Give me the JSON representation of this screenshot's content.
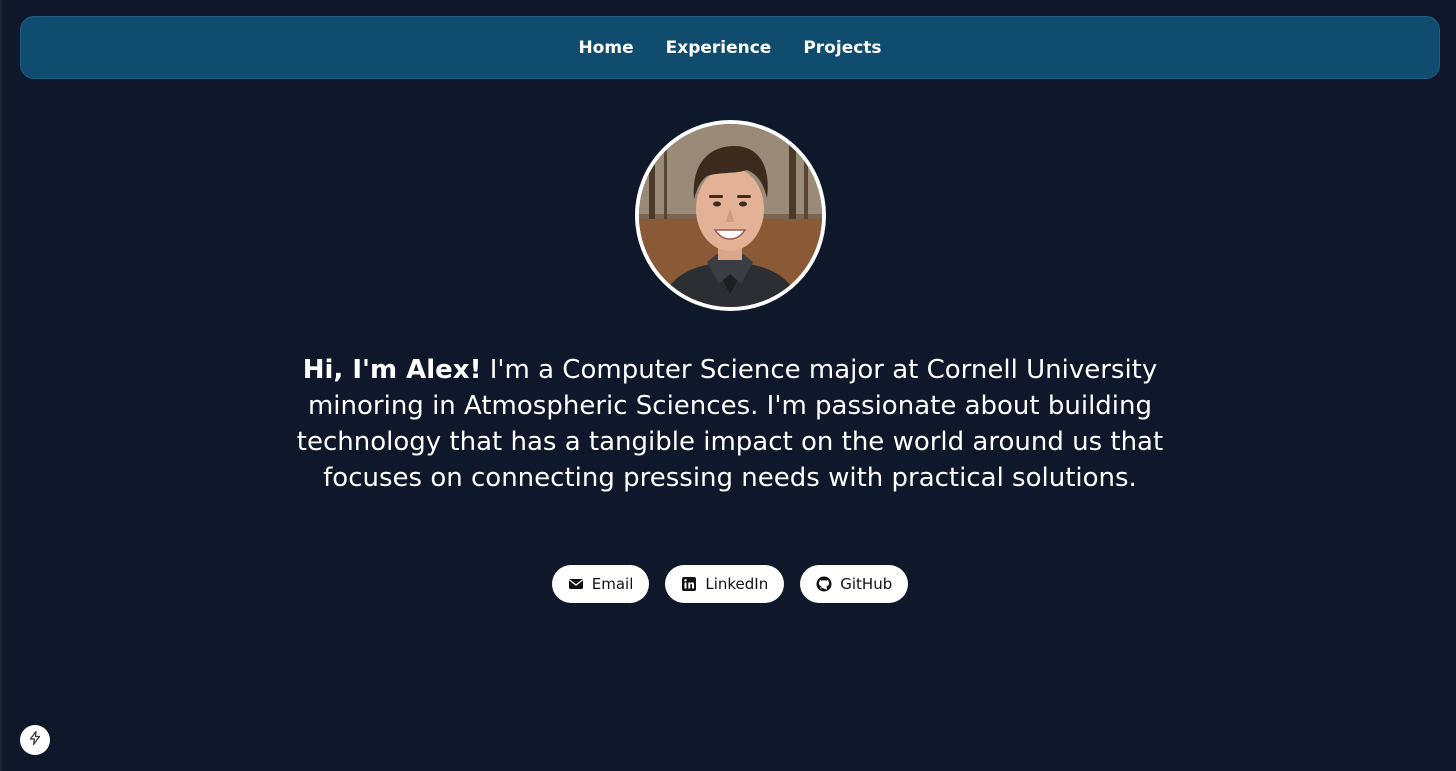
{
  "nav": {
    "items": [
      {
        "label": "Home"
      },
      {
        "label": "Experience"
      },
      {
        "label": "Projects"
      }
    ]
  },
  "hero": {
    "name_intro": "Hi, I'm Alex!",
    "bio": " I'm a Computer Science major at Cornell University minoring in Atmospheric Sciences. I'm passionate about building technology that has a tangible impact on the world around us that focuses on connecting pressing needs with practical solutions."
  },
  "links": [
    {
      "label": "Email",
      "icon": "envelope-icon"
    },
    {
      "label": "LinkedIn",
      "icon": "linkedin-icon"
    },
    {
      "label": "GitHub",
      "icon": "github-icon"
    }
  ],
  "colors": {
    "background": "#0f172a",
    "navbar": "#0f4c6e",
    "text": "#ffffff"
  }
}
